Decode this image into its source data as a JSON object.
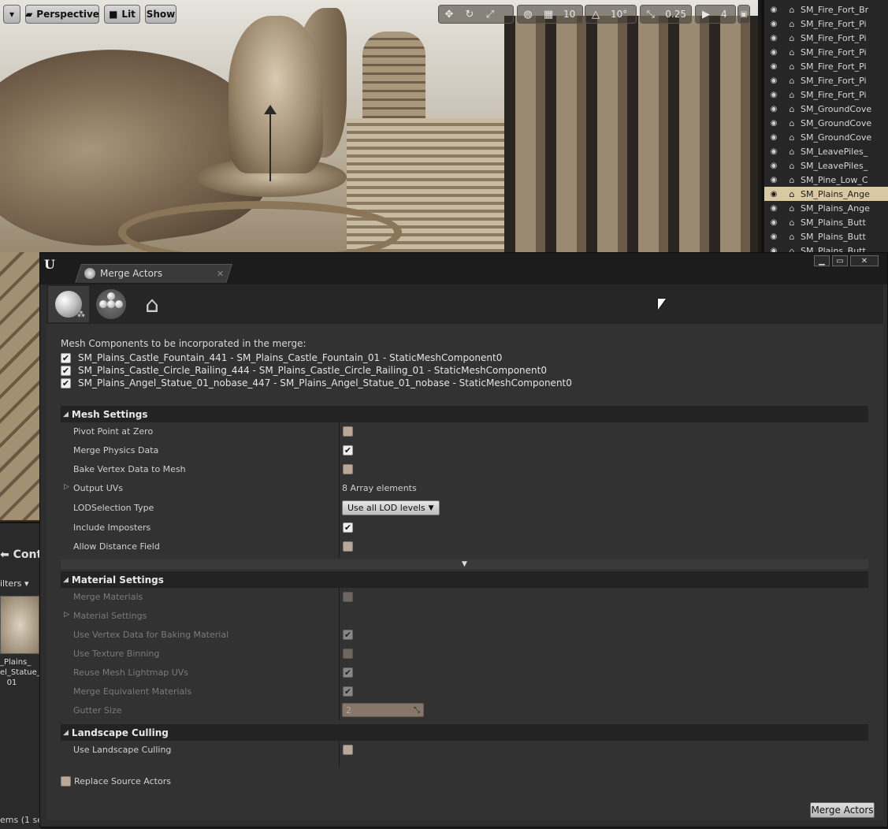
{
  "viewport": {
    "menu_arrow": "▾",
    "perspective_label": "Perspective",
    "lit_label": "Lit",
    "show_label": "Show",
    "grid_snap_value": "10",
    "rotation_snap_value": "10°",
    "scale_snap_value": "0.25",
    "camera_speed_value": "4"
  },
  "outliner": {
    "rows": [
      {
        "label": "SM_Fire_Fort_Br"
      },
      {
        "label": "SM_Fire_Fort_Pi"
      },
      {
        "label": "SM_Fire_Fort_Pi"
      },
      {
        "label": "SM_Fire_Fort_Pi"
      },
      {
        "label": "SM_Fire_Fort_Pi"
      },
      {
        "label": "SM_Fire_Fort_Pi"
      },
      {
        "label": "SM_Fire_Fort_Pi"
      },
      {
        "label": "SM_GroundCove"
      },
      {
        "label": "SM_GroundCove"
      },
      {
        "label": "SM_GroundCove"
      },
      {
        "label": "SM_LeavePiles_"
      },
      {
        "label": "SM_LeavePiles_"
      },
      {
        "label": "SM_Pine_Low_C"
      },
      {
        "label": "SM_Plains_Ange"
      },
      {
        "label": "SM_Plains_Ange"
      },
      {
        "label": "SM_Plains_Butt"
      },
      {
        "label": "SM_Plains_Butt"
      },
      {
        "label": "SM_Plains_Butt"
      }
    ]
  },
  "content_browser": {
    "tab_label": "Cont",
    "filters_label": "ilters ▾",
    "asset_label_1": "_Plains_",
    "asset_label_2": "el_Statue_",
    "asset_label_3": "01",
    "status": "ems (1 se"
  },
  "window": {
    "logo": "U",
    "minimize": "▁",
    "maximize": "▭",
    "close": "✕",
    "tab_label": "Merge Actors",
    "tab_close": "✕"
  },
  "merge": {
    "intro": "Mesh Components to be incorporated in the merge:",
    "components": [
      "SM_Plains_Castle_Fountain_441 - SM_Plains_Castle_Fountain_01 - StaticMeshComponent0",
      "SM_Plains_Castle_Circle_Railing_444 - SM_Plains_Castle_Circle_Railing_01 - StaticMeshComponent0",
      "SM_Plains_Angel_Statue_01_nobase_447 - SM_Plains_Angel_Statue_01_nobase - StaticMeshComponent0"
    ],
    "mesh_settings": {
      "title": "Mesh Settings",
      "pivot_point": "Pivot Point at Zero",
      "merge_physics": "Merge Physics Data",
      "bake_vertex": "Bake Vertex Data to Mesh",
      "output_uvs": "Output UVs",
      "output_uvs_value": "8 Array elements",
      "lod_selection": "LODSelection Type",
      "lod_selection_value": "Use all LOD levels",
      "include_imposters": "Include Imposters",
      "allow_distance_field": "Allow Distance Field"
    },
    "material_settings": {
      "title": "Material Settings",
      "merge_materials": "Merge Materials",
      "material_settings": "Material Settings",
      "use_vertex_data": "Use Vertex Data for Baking Material",
      "use_texture_binning": "Use Texture Binning",
      "reuse_lightmap": "Reuse Mesh Lightmap UVs",
      "merge_equivalent": "Merge Equivalent Materials",
      "gutter_size": "Gutter Size",
      "gutter_size_value": "2"
    },
    "landscape_culling": {
      "title": "Landscape Culling",
      "use_landscape_culling": "Use Landscape Culling"
    },
    "replace_source": "Replace Source Actors",
    "merge_button": "Merge Actors"
  }
}
